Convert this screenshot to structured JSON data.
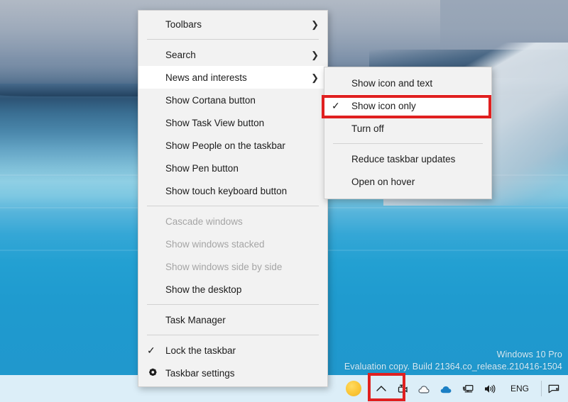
{
  "desktop": {
    "watermark": {
      "line1": "Windows 10 Pro",
      "line2": "Evaluation copy. Build 21364.co_release.210416-1504"
    }
  },
  "context_menu": {
    "name": "Taskbar context menu",
    "items": [
      {
        "label": "Toolbars",
        "submenu": true,
        "checked": false,
        "disabled": false,
        "highlight": false,
        "icon": ""
      },
      {
        "sep": true
      },
      {
        "label": "Search",
        "submenu": true,
        "checked": false,
        "disabled": false,
        "highlight": false,
        "icon": ""
      },
      {
        "label": "News and interests",
        "submenu": true,
        "checked": false,
        "disabled": false,
        "highlight": true,
        "icon": ""
      },
      {
        "label": "Show Cortana button",
        "submenu": false,
        "checked": false,
        "disabled": false,
        "highlight": false,
        "icon": ""
      },
      {
        "label": "Show Task View button",
        "submenu": false,
        "checked": false,
        "disabled": false,
        "highlight": false,
        "icon": ""
      },
      {
        "label": "Show People on the taskbar",
        "submenu": false,
        "checked": false,
        "disabled": false,
        "highlight": false,
        "icon": ""
      },
      {
        "label": "Show Pen button",
        "submenu": false,
        "checked": false,
        "disabled": false,
        "highlight": false,
        "icon": ""
      },
      {
        "label": "Show touch keyboard button",
        "submenu": false,
        "checked": false,
        "disabled": false,
        "highlight": false,
        "icon": ""
      },
      {
        "sep": true
      },
      {
        "label": "Cascade windows",
        "submenu": false,
        "checked": false,
        "disabled": true,
        "highlight": false,
        "icon": ""
      },
      {
        "label": "Show windows stacked",
        "submenu": false,
        "checked": false,
        "disabled": true,
        "highlight": false,
        "icon": ""
      },
      {
        "label": "Show windows side by side",
        "submenu": false,
        "checked": false,
        "disabled": true,
        "highlight": false,
        "icon": ""
      },
      {
        "label": "Show the desktop",
        "submenu": false,
        "checked": false,
        "disabled": false,
        "highlight": false,
        "icon": ""
      },
      {
        "sep": true
      },
      {
        "label": "Task Manager",
        "submenu": false,
        "checked": false,
        "disabled": false,
        "highlight": false,
        "icon": ""
      },
      {
        "sep": true
      },
      {
        "label": "Lock the taskbar",
        "submenu": false,
        "checked": true,
        "disabled": false,
        "highlight": false,
        "icon": ""
      },
      {
        "label": "Taskbar settings",
        "submenu": false,
        "checked": false,
        "disabled": false,
        "highlight": false,
        "icon": "gear-icon"
      }
    ]
  },
  "submenu": {
    "name": "News and interests submenu",
    "items": [
      {
        "label": "Show icon and text",
        "checked": false,
        "highlighted_box": false
      },
      {
        "label": "Show icon only",
        "checked": true,
        "highlighted_box": true
      },
      {
        "label": "Turn off",
        "checked": false,
        "highlighted_box": false
      },
      {
        "sep": true
      },
      {
        "label": "Reduce taskbar updates",
        "checked": false,
        "highlighted_box": false
      },
      {
        "label": "Open on hover",
        "checked": false,
        "highlighted_box": false
      }
    ]
  },
  "taskbar": {
    "tray": [
      {
        "name": "weather-sun-icon",
        "type": "sun",
        "label": ""
      },
      {
        "name": "show-hidden-icons-icon",
        "type": "chevron",
        "label": ""
      },
      {
        "name": "camera-icon",
        "type": "camera",
        "label": ""
      },
      {
        "name": "weather-cloud-icon",
        "type": "cloud",
        "label": ""
      },
      {
        "name": "onedrive-icon",
        "type": "onedrive",
        "label": ""
      },
      {
        "name": "network-icon",
        "type": "network",
        "label": ""
      },
      {
        "name": "volume-icon",
        "type": "volume",
        "label": ""
      },
      {
        "name": "language-indicator",
        "type": "text",
        "label": "ENG"
      },
      {
        "name": "action-center-icon",
        "type": "actioncenter",
        "label": ""
      }
    ]
  },
  "colors": {
    "highlight_red": "#e02020",
    "menu_background": "#f2f2f2",
    "menu_highlight": "#ffffff",
    "taskbar_background": "#dceef8",
    "sun_yellow": "#f5c02a",
    "onedrive_blue": "#1f7ec4",
    "watermark_text": "#d6eaf5"
  }
}
